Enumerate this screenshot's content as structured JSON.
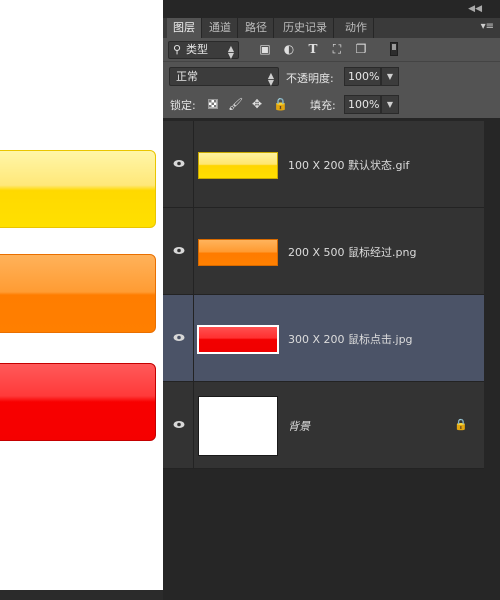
{
  "panel": {
    "tabs": [
      "图层",
      "通道",
      "路径",
      "历史记录",
      "动作"
    ],
    "filter": {
      "value": "类型",
      "icons": [
        "image-filter-icon",
        "adjustment-filter-icon",
        "type-filter-icon",
        "shape-filter-icon",
        "smart-object-filter-icon"
      ]
    },
    "blend_mode": "正常",
    "opacity_label": "不透明度:",
    "opacity_value": "100%",
    "lock_label": "锁定:",
    "fill_label": "填充:",
    "fill_value": "100%"
  },
  "layers": [
    {
      "name": "100 X 200 默认状态.gif",
      "thumb": "yellow",
      "selected": false
    },
    {
      "name": "200 X 500 鼠标经过.png",
      "thumb": "orange",
      "selected": false
    },
    {
      "name": "300 X 200 鼠标点击.jpg",
      "thumb": "red",
      "selected": true
    },
    {
      "name": "背景",
      "thumb": "white",
      "locked": true
    }
  ],
  "colors": {
    "yellow": "#ffd900",
    "orange": "#ff7f00",
    "red": "#f50000",
    "panel_bg": "#535353",
    "selected_layer": "#4b5367"
  }
}
